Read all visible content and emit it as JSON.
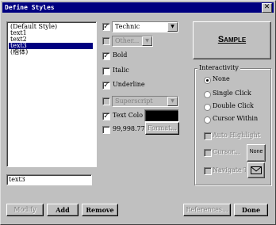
{
  "window": {
    "title": "Define Styles",
    "close_glyph": "✕"
  },
  "styles_list": {
    "items": [
      {
        "label": "(Default Style)",
        "selected": false
      },
      {
        "label": "text1",
        "selected": false
      },
      {
        "label": "text2",
        "selected": false
      },
      {
        "label": "text3",
        "selected": true
      },
      {
        "label": "(楷体)",
        "selected": false
      }
    ]
  },
  "style_name_input": {
    "value": "text3"
  },
  "font": {
    "checked": true,
    "value": "Technic"
  },
  "other": {
    "checked": false,
    "label": "Other..."
  },
  "bold": {
    "checked": true,
    "label": "Bold"
  },
  "italic": {
    "checked": false,
    "label": "Italic"
  },
  "underline": {
    "checked": true,
    "label": "Underline"
  },
  "superscript": {
    "checked": false,
    "value": "Superscript"
  },
  "text_color": {
    "checked": true,
    "label": "Text Color",
    "color": "#000000"
  },
  "number_format": {
    "checked": false,
    "label": "99,998.77",
    "button": "Format..."
  },
  "sample": {
    "text": "Sample"
  },
  "interactivity": {
    "title": "Interactivity",
    "options": [
      {
        "label": "None",
        "selected": true
      },
      {
        "label": "Single Click",
        "selected": false
      },
      {
        "label": "Double Click",
        "selected": false
      },
      {
        "label": "Cursor Within",
        "selected": false
      }
    ],
    "auto_highlight": {
      "label": "Auto Highlight",
      "checked": false
    },
    "cursor": {
      "label": "Cursor...",
      "checked": false,
      "button": "None"
    },
    "navigate": {
      "label": "Navigate To...",
      "checked": false
    }
  },
  "buttons": {
    "modify": "Modify",
    "add": "Add",
    "remove": "Remove",
    "references": "References...",
    "done": "Done"
  },
  "check_glyph": "✓",
  "arrow_glyph": "▼"
}
